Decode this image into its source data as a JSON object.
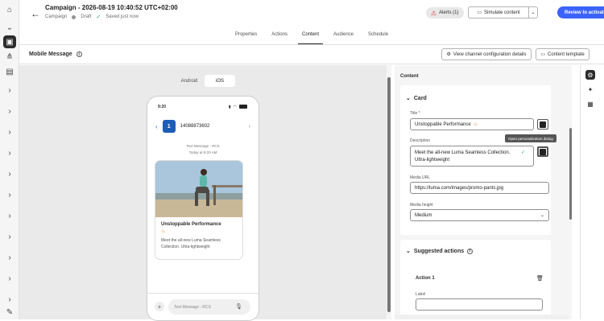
{
  "header": {
    "title": "Campaign - 2026-08-19 10:40:52 UTC+02:00",
    "breadcrumb": "Campaign",
    "status": "Draft",
    "saved": "Saved just now",
    "alerts_label": "Alerts (1)",
    "simulate_label": "Simulate content",
    "review_label": "Review to activate"
  },
  "tabs": [
    "Properties",
    "Actions",
    "Content",
    "Audience",
    "Schedule"
  ],
  "subheader": {
    "title": "Mobile Message",
    "view_config": "View channel configuration details",
    "content_template": "Content template"
  },
  "preview": {
    "os_android": "Android",
    "os_ios": "iOS",
    "time": "9:20",
    "avatar": "1",
    "contact": "14088873602",
    "msg_type": "Text Message - RCS",
    "msg_time": "Today at 9:20 AM",
    "card_title": "Unstoppable Performance",
    "card_desc": "Meet the all-new Luma Seamless Collection. Ultra-lightweight",
    "composer_placeholder": "Text Message - RCS"
  },
  "panel": {
    "title": "Content",
    "card_section": "Card",
    "title_label": "Title *",
    "title_value": "Unstoppable Performance",
    "desc_label": "Description",
    "desc_value": "Meet the all-new Luma Seamless Collection. Ultra-lightweight",
    "media_url_label": "Media URL",
    "media_url_value": "https://luma.com/images/promo-pants.jpg",
    "media_height_label": "Media height",
    "media_height_value": "Medium",
    "tooltip": "Open personalization dialog",
    "suggested_section": "Suggested actions",
    "action_title": "Action 1",
    "action_label": "Label"
  },
  "colors": {
    "accent": "#3b63fb",
    "alert": "#d7373f"
  }
}
